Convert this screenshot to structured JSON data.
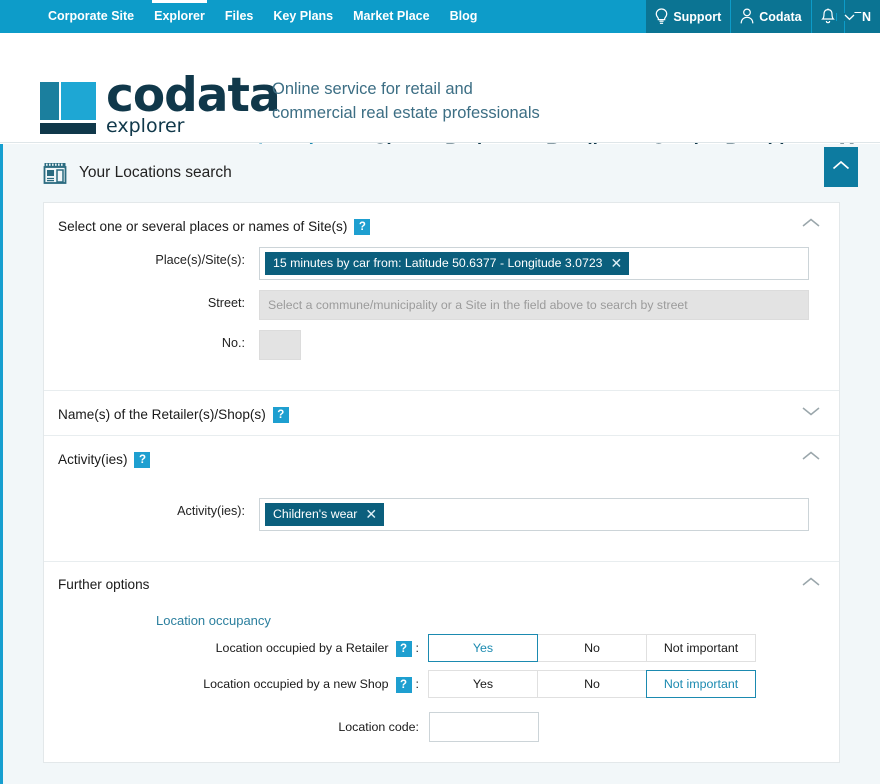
{
  "topbar": {
    "links": [
      {
        "label": "Corporate Site",
        "active": false
      },
      {
        "label": "Explorer",
        "active": true
      },
      {
        "label": "Files",
        "active": false
      },
      {
        "label": "Key Plans",
        "active": false
      },
      {
        "label": "Market Place",
        "active": false
      },
      {
        "label": "Blog",
        "active": false
      }
    ],
    "support_label": "Support",
    "account_label": "Codata",
    "language_label": "EN",
    "icons": {
      "support": "lightbulb-icon",
      "account": "person-icon",
      "notifications": "bell-icon",
      "chevron": "chevron-down-icon"
    }
  },
  "brand": {
    "logo_primary": "codata",
    "logo_secondary": "explorer",
    "tagline_line1": "Online service for retail and",
    "tagline_line2": "commercial real estate professionals"
  },
  "mainnav": [
    {
      "label": "Locations",
      "active": true
    },
    {
      "label": "Sites",
      "active": false
    },
    {
      "label": "Projects",
      "active": false
    },
    {
      "label": "Retailers",
      "active": false
    },
    {
      "label": "Service Providers",
      "active": false
    },
    {
      "label": "Maps",
      "active": false
    }
  ],
  "panel": {
    "title": "Your Locations search",
    "icon": "shop-storefront-icon",
    "collapse_icon": "chevron-up-icon"
  },
  "sections": {
    "places": {
      "title": "Select one or several places or names of Site(s)",
      "help": "?",
      "expanded": true,
      "chevron": "chevron-up-icon",
      "place_label": "Place(s)/Site(s):",
      "place_tag": "15 minutes by car from: Latitude 50.6377 - Longitude 3.0723",
      "place_tag_remove": "✕",
      "street_label": "Street:",
      "street_placeholder": "Select a commune/municipality or a Site in the field above to search by street",
      "no_label": "No.:",
      "no_value": ""
    },
    "retailers": {
      "title": "Name(s) of the Retailer(s)/Shop(s)",
      "help": "?",
      "expanded": false,
      "chevron": "chevron-down-icon"
    },
    "activities": {
      "title": "Activity(ies)",
      "help": "?",
      "expanded": true,
      "chevron": "chevron-up-icon",
      "field_label": "Activity(ies):",
      "tag": "Children's wear",
      "tag_remove": "✕"
    },
    "further": {
      "title": "Further options",
      "expanded": true,
      "chevron": "chevron-up-icon",
      "subheading": "Location occupancy",
      "rows": [
        {
          "label": "Location occupied by a Retailer",
          "help": "?",
          "suffix": ":",
          "options": [
            "Yes",
            "No",
            "Not important"
          ],
          "selected": 0
        },
        {
          "label": "Location occupied by a new Shop",
          "help": "?",
          "suffix": ":",
          "options": [
            "Yes",
            "No",
            "Not important"
          ],
          "selected": 2
        }
      ],
      "code_label": "Location code:",
      "code_value": ""
    }
  },
  "colors": {
    "topbar": "#0d9cc9",
    "topbar_dark": "#0b7493",
    "accent": "#1b8ab0",
    "tag": "#0b5f7d",
    "brand_dark": "#10384a",
    "help_badge": "#1e9fd0"
  }
}
